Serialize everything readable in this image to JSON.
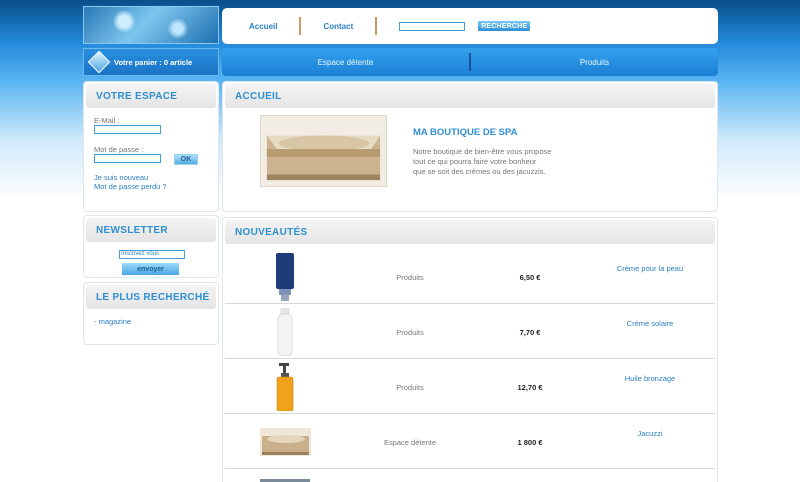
{
  "header": {
    "nav": {
      "accueil": "Accueil",
      "contact": "Contact"
    },
    "search": {
      "value": "",
      "button": "RECHERCHE"
    },
    "cart": {
      "text": "Votre panier : 0 article"
    },
    "categories": [
      "Espace détente",
      "Produits"
    ]
  },
  "sidebar": {
    "account": {
      "title": "VOTRE ESPACE",
      "email_label": "E-Mail :",
      "password_label": "Mot de passe :",
      "ok": "OK",
      "new_user": "Je suis nouveau",
      "lost_password": "Mot de passe perdu ?"
    },
    "newsletter": {
      "title": "NEWSLETTER",
      "placeholder": "Inscrivez vous",
      "button": "envoyer"
    },
    "popular": {
      "title": "LE PLUS RECHERCHÉ",
      "items": [
        "- magazine"
      ]
    }
  },
  "main": {
    "home": {
      "title": "ACCUEIL",
      "shop_title": "MA BOUTIQUE DE SPA",
      "description": [
        "Notre boutique de bien-être vous propose",
        "tout ce qui pourra faire votre bonheur",
        "que se soit des crèmes ou des jacuzzis."
      ]
    },
    "news": {
      "title": "NOUVEAUTÉS",
      "products": [
        {
          "category": "Produits",
          "price": "6,50 €",
          "name": "Crème pour la peau",
          "icon": "tube-icon"
        },
        {
          "category": "Produits",
          "price": "7,70 €",
          "name": "Crème solaire",
          "icon": "bottle-icon"
        },
        {
          "category": "Produits",
          "price": "12,70 €",
          "name": "Huile bronzage",
          "icon": "pump-bottle-icon"
        },
        {
          "category": "Espace détente",
          "price": "1 800 €",
          "name": "Jacuzzi",
          "icon": "jacuzzi-icon"
        }
      ]
    }
  }
}
